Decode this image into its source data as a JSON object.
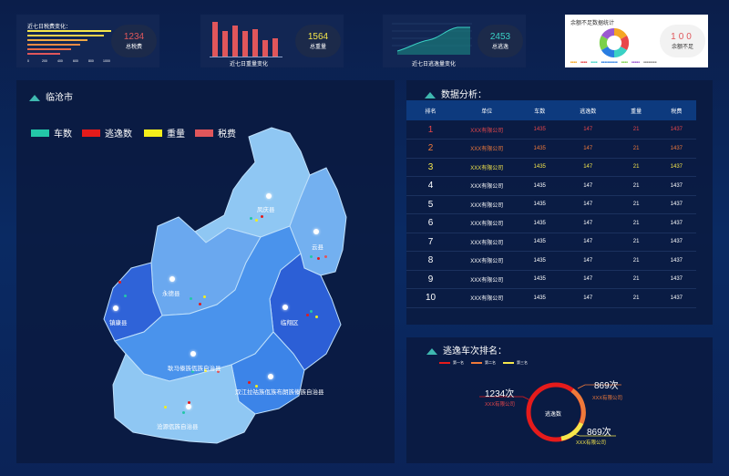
{
  "kpis": [
    {
      "title": "近七日税费变化：",
      "value": "1234",
      "caption": "总税费",
      "value_color": "#e0565b"
    },
    {
      "title": "近七日重量变化",
      "value": "1564",
      "caption": "总重量",
      "value_color": "#f5e64b"
    },
    {
      "title": "近七日逃逸量变化",
      "value": "2453",
      "caption": "总逃逸",
      "value_color": "#3ad1c5"
    },
    {
      "title": "余额不足数据统计",
      "value": "100",
      "caption": "余额不足",
      "value_color": "#e0565b"
    }
  ],
  "kpi1_axis": [
    "0",
    "200",
    "400",
    "600",
    "800",
    "1000"
  ],
  "kpi4_legend": [
    "■■■■",
    "■■■■",
    "■■■■",
    "■■■■■■■■■■",
    "■■■■",
    "■■■■■",
    "■■■■■■■■"
  ],
  "map_panel": {
    "title": "临沧市",
    "legend": [
      {
        "label": "车数",
        "color": "#23c7a8"
      },
      {
        "label": "逃逸数",
        "color": "#e51b1b"
      },
      {
        "label": "重量",
        "color": "#f5ee1a"
      },
      {
        "label": "税费",
        "color": "#e0565b"
      }
    ],
    "regions": [
      "凤庆县",
      "云县",
      "永德县",
      "镇康县",
      "临翔区",
      "耿马傣族佤族自治县",
      "双江拉祜族佤族布朗族傣族自治县",
      "沧源佤族自治县"
    ]
  },
  "table_panel": {
    "title": "数据分析：",
    "headers": [
      "排名",
      "单位",
      "车数",
      "逃逸数",
      "重量",
      "税费"
    ],
    "rows": [
      {
        "rank": "1",
        "unit": "XXX有限公司",
        "cars": "1435",
        "escape": "147",
        "weight": "21",
        "tax": "1437",
        "color": "#e8474a"
      },
      {
        "rank": "2",
        "unit": "XXX有限公司",
        "cars": "1435",
        "escape": "147",
        "weight": "21",
        "tax": "1437",
        "color": "#f07a3a"
      },
      {
        "rank": "3",
        "unit": "XXX有限公司",
        "cars": "1435",
        "escape": "147",
        "weight": "21",
        "tax": "1437",
        "color": "#f5e64b"
      },
      {
        "rank": "4",
        "unit": "XXX有限公司",
        "cars": "1435",
        "escape": "147",
        "weight": "21",
        "tax": "1437",
        "color": "#ffffff"
      },
      {
        "rank": "5",
        "unit": "XXX有限公司",
        "cars": "1435",
        "escape": "147",
        "weight": "21",
        "tax": "1437",
        "color": "#ffffff"
      },
      {
        "rank": "6",
        "unit": "XXX有限公司",
        "cars": "1435",
        "escape": "147",
        "weight": "21",
        "tax": "1437",
        "color": "#ffffff"
      },
      {
        "rank": "7",
        "unit": "XXX有限公司",
        "cars": "1435",
        "escape": "147",
        "weight": "21",
        "tax": "1437",
        "color": "#ffffff"
      },
      {
        "rank": "8",
        "unit": "XXX有限公司",
        "cars": "1435",
        "escape": "147",
        "weight": "21",
        "tax": "1437",
        "color": "#ffffff"
      },
      {
        "rank": "9",
        "unit": "XXX有限公司",
        "cars": "1435",
        "escape": "147",
        "weight": "21",
        "tax": "1437",
        "color": "#ffffff"
      },
      {
        "rank": "10",
        "unit": "XXX有限公司",
        "cars": "1435",
        "escape": "147",
        "weight": "21",
        "tax": "1437",
        "color": "#ffffff"
      }
    ]
  },
  "ring_panel": {
    "title": "逃逸车次排名：",
    "legend": [
      {
        "label": "第一名",
        "color": "#e51b1b"
      },
      {
        "label": "第二名",
        "color": "#f07a3a"
      },
      {
        "label": "第三名",
        "color": "#f5e64b"
      }
    ],
    "center": "逃逸数",
    "callouts": [
      {
        "value": "1234次",
        "company": "XXX有限公司"
      },
      {
        "value": "869次",
        "company": "XXX有限公司"
      },
      {
        "value": "869次",
        "company": "XXX有限公司"
      }
    ]
  }
}
